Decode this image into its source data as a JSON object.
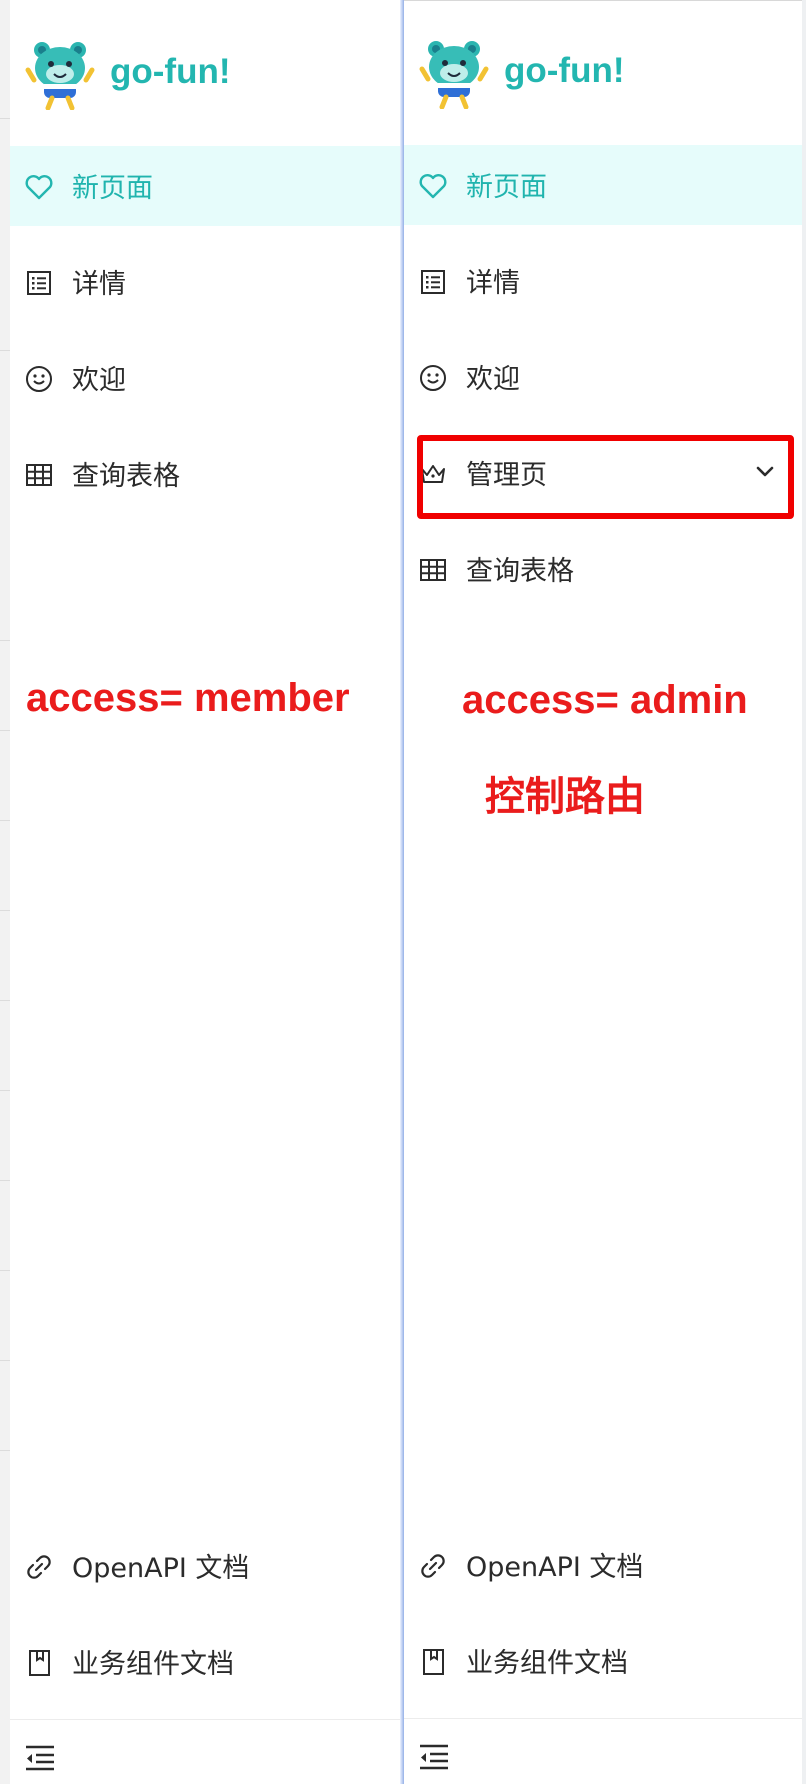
{
  "app": {
    "brand_name": "go-fun!"
  },
  "colors": {
    "accent": "#23b6b0",
    "selected_bg": "#e6fcfb",
    "annotation": "#ea1c1c"
  },
  "panels": [
    {
      "annotation": "access= member",
      "menu": [
        {
          "label": "新页面",
          "icon": "heart-icon",
          "selected": true
        },
        {
          "label": "详情",
          "icon": "profile-list-icon"
        },
        {
          "label": "欢迎",
          "icon": "smile-icon"
        },
        {
          "label": "查询表格",
          "icon": "table-icon"
        }
      ],
      "bottom_links": [
        {
          "label": "OpenAPI 文档",
          "icon": "link-icon"
        },
        {
          "label": "业务组件文档",
          "icon": "book-icon"
        }
      ],
      "collapse_icon": "menu-fold-icon"
    },
    {
      "annotation": "access= admin",
      "annotation_note": "控制路由",
      "menu": [
        {
          "label": "新页面",
          "icon": "heart-icon",
          "selected": true
        },
        {
          "label": "详情",
          "icon": "profile-list-icon"
        },
        {
          "label": "欢迎",
          "icon": "smile-icon"
        },
        {
          "label": "管理页",
          "icon": "crown-icon",
          "has_submenu": true,
          "expand_icon": "chevron-down-icon"
        },
        {
          "label": "查询表格",
          "icon": "table-icon"
        }
      ],
      "bottom_links": [
        {
          "label": "OpenAPI 文档",
          "icon": "link-icon"
        },
        {
          "label": "业务组件文档",
          "icon": "book-icon"
        }
      ],
      "collapse_icon": "menu-fold-icon"
    }
  ]
}
